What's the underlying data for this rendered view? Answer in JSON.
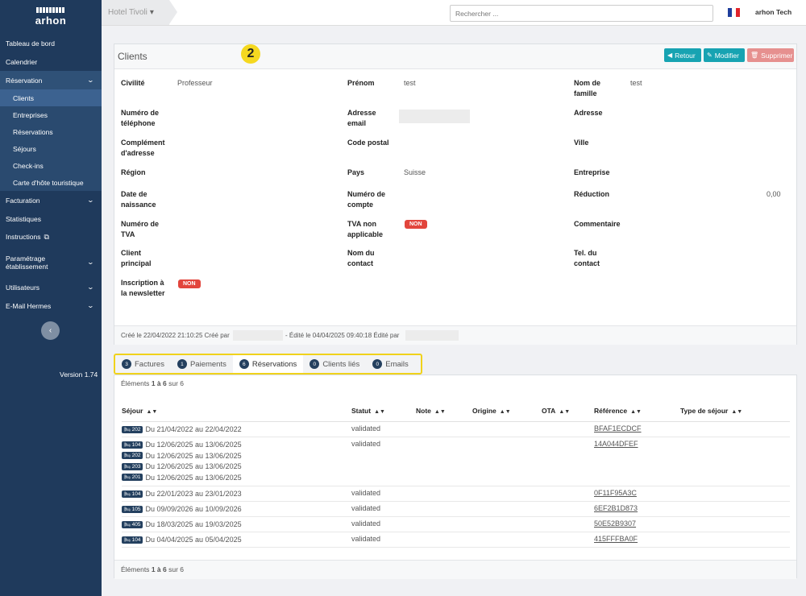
{
  "sidebar": {
    "logo_text": "arhon",
    "items": [
      {
        "label": "Tableau de bord"
      },
      {
        "label": "Calendrier"
      }
    ],
    "reservation_section": "Réservation",
    "reservation_sub": [
      "Clients",
      "Entreprises",
      "Réservations",
      "Séjours",
      "Check-ins",
      "Carte d'hôte touristique"
    ],
    "bottom_items": [
      "Facturation",
      "Statistiques",
      "Instructions",
      "Paramétrage établissement",
      "Utilisateurs",
      "E-Mail Hermes"
    ],
    "version": "Version 1.74"
  },
  "topbar": {
    "hotel": "Hotel Tivoli",
    "search_placeholder": "Rechercher ...",
    "user": "arhon Tech"
  },
  "client": {
    "title": "Clients",
    "annotation": "2",
    "buttons": {
      "back": "Retour",
      "edit": "Modifier",
      "delete": "Supprimer"
    },
    "labels": {
      "civilite": "Civilité",
      "prenom": "Prénom",
      "nom": "Nom de famille",
      "tel": "Numéro de téléphone",
      "email": "Adresse email",
      "adresse": "Adresse",
      "complement": "Complément d'adresse",
      "cp": "Code postal",
      "ville": "Ville",
      "region": "Région",
      "pays": "Pays",
      "entreprise": "Entreprise",
      "naissance": "Date de naissance",
      "compte": "Numéro de compte",
      "reduction": "Réduction",
      "tva_num": "Numéro de TVA",
      "tva_na": "TVA non applicable",
      "commentaire": "Commentaire",
      "client_principal": "Client principal",
      "contact": "Nom du contact",
      "tel_contact": "Tel. du contact",
      "newsletter": "Inscription à la newsletter"
    },
    "values": {
      "civilite": "Professeur",
      "prenom": "test",
      "nom": "test",
      "pays": "Suisse",
      "reduction": "0,00",
      "tva_na": "NON",
      "newsletter": "NON"
    },
    "meta": {
      "created": "Créé le 22/04/2022 21:10:25 Créé par",
      "edited": "- Édité le 04/04/2025 09:40:18 Édité par"
    }
  },
  "tabs": [
    {
      "count": "3",
      "label": "Factures"
    },
    {
      "count": "1",
      "label": "Paiements"
    },
    {
      "count": "6",
      "label": "Réservations"
    },
    {
      "count": "0",
      "label": "Clients liés"
    },
    {
      "count": "0",
      "label": "Emails"
    }
  ],
  "reservations": {
    "elements_prefix": "Éléments",
    "elements_range": "1 à 6",
    "elements_suffix": "sur 6",
    "columns": [
      "Séjour",
      "Statut",
      "Note",
      "Origine",
      "OTA",
      "Référence",
      "Type de séjour"
    ],
    "rows": [
      {
        "stays": [
          {
            "room": "202",
            "dates": "Du 21/04/2022 au 22/04/2022"
          }
        ],
        "statut": "validated",
        "ref": "BFAF1ECDCF"
      },
      {
        "stays": [
          {
            "room": "104",
            "dates": "Du 12/06/2025 au 13/06/2025"
          },
          {
            "room": "202",
            "dates": "Du 12/06/2025 au 13/06/2025"
          },
          {
            "room": "203",
            "dates": "Du 12/06/2025 au 13/06/2025"
          },
          {
            "room": "201",
            "dates": "Du 12/06/2025 au 13/06/2025"
          }
        ],
        "statut": "validated",
        "ref": "14A044DFEF"
      },
      {
        "stays": [
          {
            "room": "104",
            "dates": "Du 22/01/2023 au 23/01/2023"
          }
        ],
        "statut": "validated",
        "ref": "0F11F95A3C"
      },
      {
        "stays": [
          {
            "room": "105",
            "dates": "Du 09/09/2026 au 10/09/2026"
          }
        ],
        "statut": "validated",
        "ref": "6EF2B1D873"
      },
      {
        "stays": [
          {
            "room": "405",
            "dates": "Du 18/03/2025 au 19/03/2025"
          }
        ],
        "statut": "validated",
        "ref": "50E52B9307"
      },
      {
        "stays": [
          {
            "room": "104",
            "dates": "Du 04/04/2025 au 05/04/2025"
          }
        ],
        "statut": "validated",
        "ref": "415FFFBA0F"
      }
    ]
  }
}
